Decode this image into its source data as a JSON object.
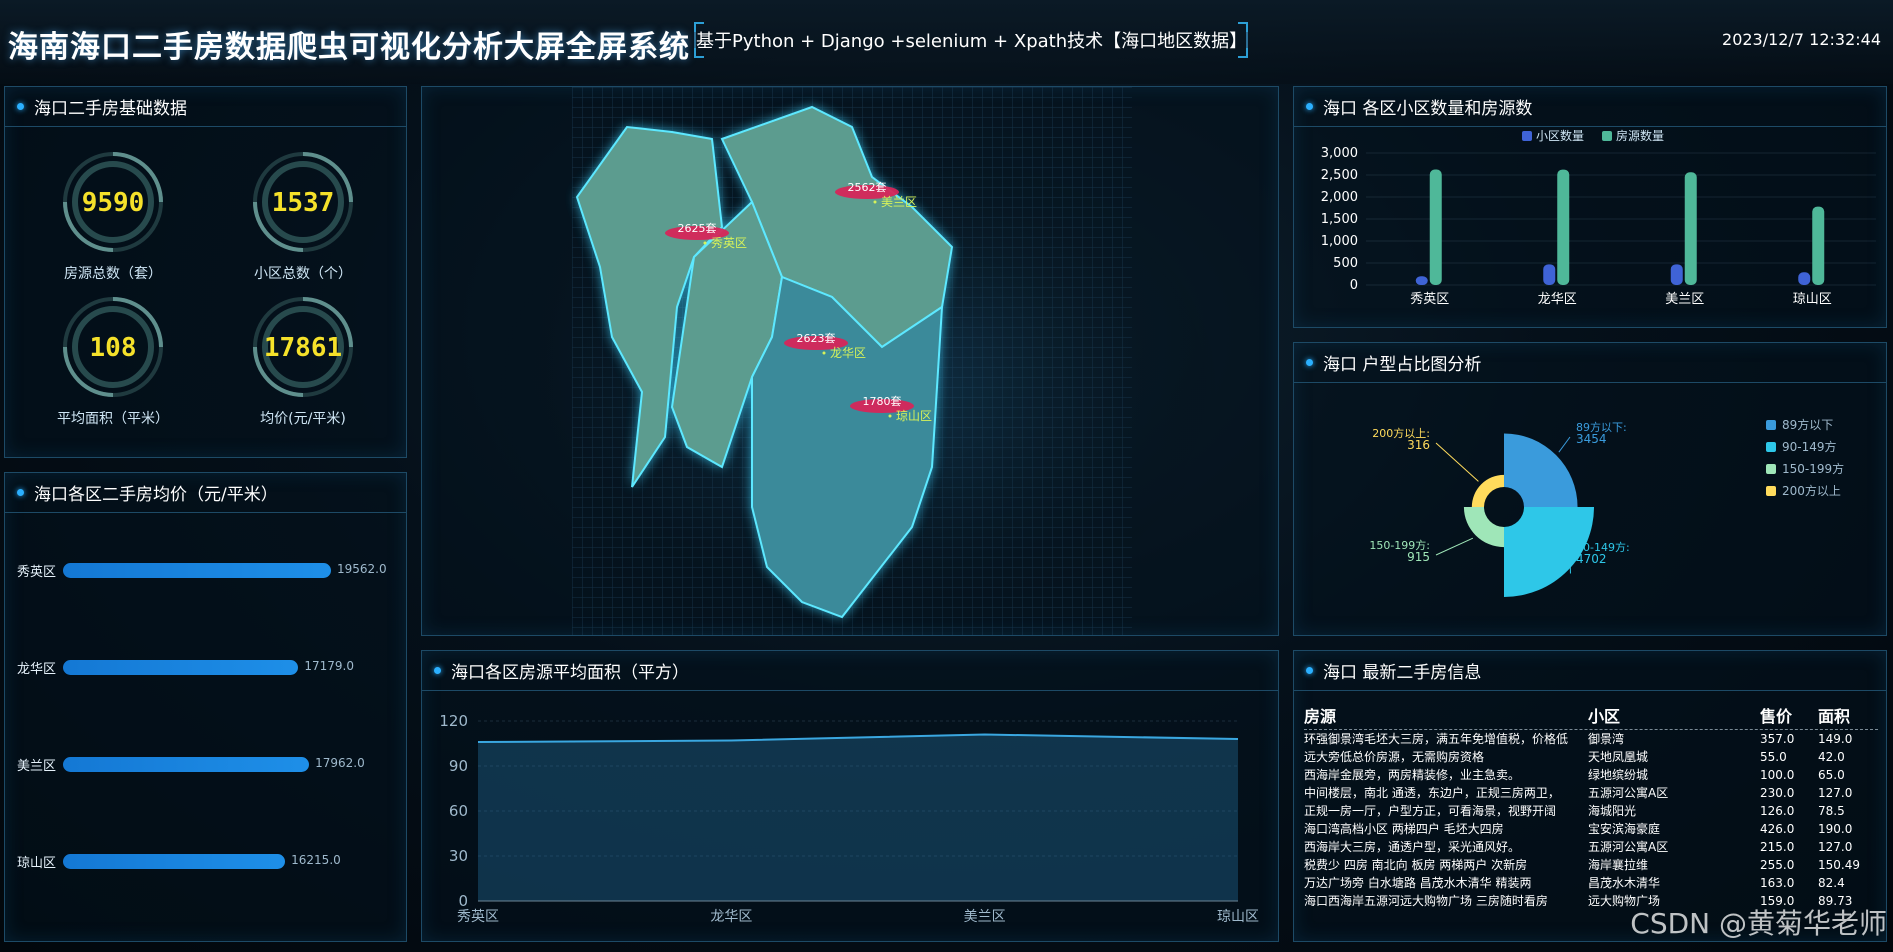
{
  "header": {
    "title": "海南海口二手房数据爬虫可视化分析大屏全屏系统",
    "subtitle": "基于Python + Django +selenium + Xpath技术【海口地区数据】",
    "datetime": "2023/12/7 12:32:44"
  },
  "basic": {
    "title": "海口二手房基础数据",
    "stats": [
      {
        "value": "9590",
        "label": "房源总数（套）"
      },
      {
        "value": "1537",
        "label": "小区总数（个）"
      },
      {
        "value": "108",
        "label": "平均面积（平米）"
      },
      {
        "value": "17861",
        "label": "均价(元/平米)"
      }
    ]
  },
  "price": {
    "title": "海口各区二手房均价（元/平米）",
    "chart_data": {
      "type": "bar",
      "orientation": "horizontal",
      "categories": [
        "秀英区",
        "龙华区",
        "美兰区",
        "琼山区"
      ],
      "values": [
        19562.0,
        17179.0,
        17962.0,
        16215.0
      ],
      "value_labels": [
        "19562.0",
        "17179.0",
        "17962.0",
        "16215.0"
      ],
      "max": 19562.0
    }
  },
  "map": {
    "labels": [
      {
        "count": "2625套",
        "district": "秀英区"
      },
      {
        "count": "2562套",
        "district": "美兰区"
      },
      {
        "count": "2623套",
        "district": "龙华区"
      },
      {
        "count": "1780套",
        "district": "琼山区"
      }
    ]
  },
  "area": {
    "title": "海口各区房源平均面积（平方）",
    "chart_data": {
      "type": "area",
      "categories": [
        "秀英区",
        "龙华区",
        "美兰区",
        "琼山区"
      ],
      "values": [
        106,
        107,
        111,
        108
      ],
      "ylim": [
        0,
        120
      ],
      "yticks": [
        "0",
        "30",
        "60",
        "90",
        "120"
      ],
      "grid": true
    }
  },
  "district": {
    "title": "海口 各区小区数量和房源数",
    "chart_data": {
      "type": "bar",
      "categories": [
        "秀英区",
        "龙华区",
        "美兰区",
        "琼山区"
      ],
      "series": [
        {
          "name": "小区数量",
          "values": [
            200,
            470,
            470,
            290
          ],
          "color": "#3f63d6"
        },
        {
          "name": "房源数量",
          "values": [
            2625,
            2623,
            2562,
            1780
          ],
          "color": "#4fb899"
        }
      ],
      "ylim": [
        0,
        3000
      ],
      "yticks": [
        "0",
        "500",
        "1,000",
        "1,500",
        "2,000",
        "2,500",
        "3,000"
      ],
      "legend": "top"
    }
  },
  "layout": {
    "title": "海口 户型占比图分析",
    "chart_data": {
      "type": "pie",
      "rose": true,
      "slices": [
        {
          "name": "89方以下",
          "value": 3454,
          "label": "89方以下:",
          "color": "#3a9bdc"
        },
        {
          "name": "90-149方",
          "value": 4702,
          "label": "90-149方:",
          "color": "#2ec7e8"
        },
        {
          "name": "150-199方",
          "value": 915,
          "label": "150-199方:",
          "color": "#9fe6b8"
        },
        {
          "name": "200方以上",
          "value": 316,
          "label": "200方以上:",
          "color": "#ffdb5c"
        }
      ],
      "legend": "right"
    }
  },
  "latest": {
    "title": "海口 最新二手房信息",
    "headers": [
      "房源",
      "小区",
      "售价",
      "面积"
    ],
    "rows": [
      [
        "环强御景湾毛坯大三房，满五年免增值税，价格低",
        "御景湾",
        "357.0",
        "149.0"
      ],
      [
        "远大旁低总价房源，无需购房资格",
        "天地凤凰城",
        "55.0",
        "42.0"
      ],
      [
        "西海岸金展旁，两房精装修，业主急卖。",
        "绿地缤纷城",
        "100.0",
        "65.0"
      ],
      [
        "中间楼层，南北 通透，东边户，正规三房两卫，",
        "五源河公寓A区",
        "230.0",
        "127.0"
      ],
      [
        "正规一房一厅，户型方正，可看海景，视野开阔",
        "海城阳光",
        "126.0",
        "78.5"
      ],
      [
        "海口湾高档小区 两梯四户 毛坯大四房",
        "宝安滨海豪庭",
        "426.0",
        "190.0"
      ],
      [
        "西海岸大三房，通透户型，采光通风好。",
        "五源河公寓A区",
        "215.0",
        "127.0"
      ],
      [
        "税费少 四房 南北向 板房 两梯两户 次新房",
        "海岸襄拉维",
        "255.0",
        "150.49"
      ],
      [
        "万达广场旁 白水塘路 昌茂水木清华 精装两",
        "昌茂水木清华",
        "163.0",
        "82.4"
      ],
      [
        "海口西海岸五源河远大购物广场 三房随时看房",
        "远大购物广场",
        "159.0",
        "89.73"
      ]
    ]
  },
  "watermark": "CSDN @黄菊华老师"
}
